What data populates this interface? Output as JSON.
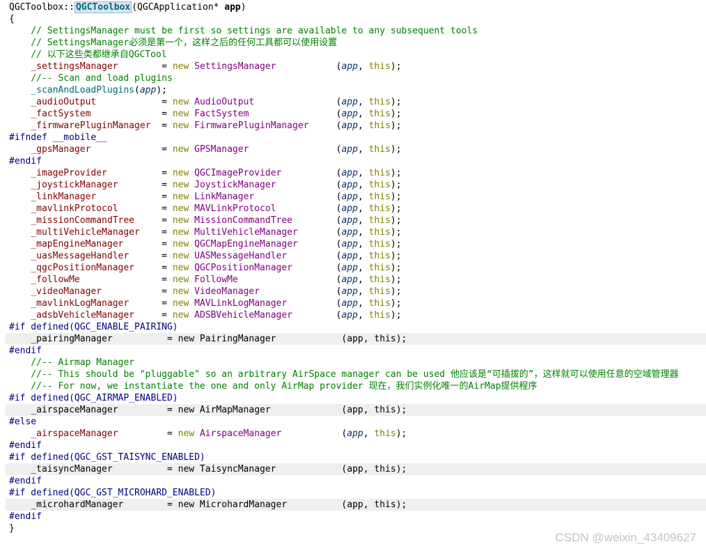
{
  "watermark": "CSDN @weixin_43409627",
  "lines": [
    {
      "disabled": false,
      "tokens": [
        {
          "t": "QGCToolbox",
          "c": "ctx"
        },
        {
          "t": "::",
          "c": "ctx"
        },
        {
          "t": "QGCToolbox",
          "c": "hl"
        },
        {
          "t": "(",
          "c": "ctx"
        },
        {
          "t": "QGCApplication",
          "c": "ctx"
        },
        {
          "t": "* ",
          "c": "ctx"
        },
        {
          "t": "app",
          "c": "ctx bold"
        },
        {
          "t": ")",
          "c": "ctx"
        }
      ]
    },
    {
      "disabled": false,
      "tokens": [
        {
          "t": "{",
          "c": "ctx"
        }
      ]
    },
    {
      "disabled": false,
      "tokens": [
        {
          "t": "    // SettingsManager must be first so settings are available to any subsequent tools",
          "c": "cmt"
        }
      ]
    },
    {
      "disabled": false,
      "tokens": [
        {
          "t": "    // SettingsManager必须是第一个，这样之后的任何工具都可以使用设置",
          "c": "cmt"
        }
      ]
    },
    {
      "disabled": false,
      "tokens": [
        {
          "t": "    // 以下这些类都继承自QGCTool",
          "c": "cmt"
        }
      ]
    },
    {
      "disabled": false,
      "tokens": [
        {
          "t": "    _settingsManager",
          "c": "mem"
        },
        {
          "t": "        = ",
          "c": "ctx"
        },
        {
          "t": "new",
          "c": "kw"
        },
        {
          "t": " ",
          "c": "ctx"
        },
        {
          "t": "SettingsManager",
          "c": "type"
        },
        {
          "t": "           (",
          "c": "ctx"
        },
        {
          "t": "app",
          "c": "par"
        },
        {
          "t": ", ",
          "c": "ctx"
        },
        {
          "t": "this",
          "c": "kw"
        },
        {
          "t": ");",
          "c": "ctx"
        }
      ]
    },
    {
      "disabled": false,
      "tokens": [
        {
          "t": "    //-- Scan and load plugins",
          "c": "cmt"
        }
      ]
    },
    {
      "disabled": false,
      "tokens": [
        {
          "t": "    _scanAndLoadPlugins",
          "c": "fn"
        },
        {
          "t": "(",
          "c": "ctx"
        },
        {
          "t": "app",
          "c": "par"
        },
        {
          "t": ");",
          "c": "ctx"
        }
      ]
    },
    {
      "disabled": false,
      "tokens": [
        {
          "t": "    _audioOutput",
          "c": "mem"
        },
        {
          "t": "            = ",
          "c": "ctx"
        },
        {
          "t": "new",
          "c": "kw"
        },
        {
          "t": " ",
          "c": "ctx"
        },
        {
          "t": "AudioOutput",
          "c": "type"
        },
        {
          "t": "               (",
          "c": "ctx"
        },
        {
          "t": "app",
          "c": "par"
        },
        {
          "t": ", ",
          "c": "ctx"
        },
        {
          "t": "this",
          "c": "kw"
        },
        {
          "t": ");",
          "c": "ctx"
        }
      ]
    },
    {
      "disabled": false,
      "tokens": [
        {
          "t": "    _factSystem",
          "c": "mem"
        },
        {
          "t": "             = ",
          "c": "ctx"
        },
        {
          "t": "new",
          "c": "kw"
        },
        {
          "t": " ",
          "c": "ctx"
        },
        {
          "t": "FactSystem",
          "c": "type"
        },
        {
          "t": "                (",
          "c": "ctx"
        },
        {
          "t": "app",
          "c": "par"
        },
        {
          "t": ", ",
          "c": "ctx"
        },
        {
          "t": "this",
          "c": "kw"
        },
        {
          "t": ");",
          "c": "ctx"
        }
      ]
    },
    {
      "disabled": false,
      "tokens": [
        {
          "t": "    _firmwarePluginManager",
          "c": "mem"
        },
        {
          "t": "  = ",
          "c": "ctx"
        },
        {
          "t": "new",
          "c": "kw"
        },
        {
          "t": " ",
          "c": "ctx"
        },
        {
          "t": "FirmwarePluginManager",
          "c": "type"
        },
        {
          "t": "     (",
          "c": "ctx"
        },
        {
          "t": "app",
          "c": "par"
        },
        {
          "t": ", ",
          "c": "ctx"
        },
        {
          "t": "this",
          "c": "kw"
        },
        {
          "t": ");",
          "c": "ctx"
        }
      ]
    },
    {
      "disabled": false,
      "tokens": [
        {
          "t": "#ifndef __mobile__",
          "c": "pp"
        }
      ]
    },
    {
      "disabled": false,
      "tokens": [
        {
          "t": "    _gpsManager",
          "c": "mem"
        },
        {
          "t": "             = ",
          "c": "ctx"
        },
        {
          "t": "new",
          "c": "kw"
        },
        {
          "t": " ",
          "c": "ctx"
        },
        {
          "t": "GPSManager",
          "c": "type"
        },
        {
          "t": "                (",
          "c": "ctx"
        },
        {
          "t": "app",
          "c": "par"
        },
        {
          "t": ", ",
          "c": "ctx"
        },
        {
          "t": "this",
          "c": "kw"
        },
        {
          "t": ");",
          "c": "ctx"
        }
      ]
    },
    {
      "disabled": false,
      "tokens": [
        {
          "t": "#endif",
          "c": "pp"
        }
      ]
    },
    {
      "disabled": false,
      "tokens": [
        {
          "t": "    _imageProvider",
          "c": "mem"
        },
        {
          "t": "          = ",
          "c": "ctx"
        },
        {
          "t": "new",
          "c": "kw"
        },
        {
          "t": " ",
          "c": "ctx"
        },
        {
          "t": "QGCImageProvider",
          "c": "type"
        },
        {
          "t": "          (",
          "c": "ctx"
        },
        {
          "t": "app",
          "c": "par"
        },
        {
          "t": ", ",
          "c": "ctx"
        },
        {
          "t": "this",
          "c": "kw"
        },
        {
          "t": ");",
          "c": "ctx"
        }
      ]
    },
    {
      "disabled": false,
      "tokens": [
        {
          "t": "    _joystickManager",
          "c": "mem"
        },
        {
          "t": "        = ",
          "c": "ctx"
        },
        {
          "t": "new",
          "c": "kw"
        },
        {
          "t": " ",
          "c": "ctx"
        },
        {
          "t": "JoystickManager",
          "c": "type"
        },
        {
          "t": "           (",
          "c": "ctx"
        },
        {
          "t": "app",
          "c": "par"
        },
        {
          "t": ", ",
          "c": "ctx"
        },
        {
          "t": "this",
          "c": "kw"
        },
        {
          "t": ");",
          "c": "ctx"
        }
      ]
    },
    {
      "disabled": false,
      "tokens": [
        {
          "t": "    _linkManager",
          "c": "mem"
        },
        {
          "t": "            = ",
          "c": "ctx"
        },
        {
          "t": "new",
          "c": "kw"
        },
        {
          "t": " ",
          "c": "ctx"
        },
        {
          "t": "LinkManager",
          "c": "type"
        },
        {
          "t": "               (",
          "c": "ctx"
        },
        {
          "t": "app",
          "c": "par"
        },
        {
          "t": ", ",
          "c": "ctx"
        },
        {
          "t": "this",
          "c": "kw"
        },
        {
          "t": ");",
          "c": "ctx"
        }
      ]
    },
    {
      "disabled": false,
      "tokens": [
        {
          "t": "    _mavlinkProtocol",
          "c": "mem"
        },
        {
          "t": "        = ",
          "c": "ctx"
        },
        {
          "t": "new",
          "c": "kw"
        },
        {
          "t": " ",
          "c": "ctx"
        },
        {
          "t": "MAVLinkProtocol",
          "c": "type"
        },
        {
          "t": "           (",
          "c": "ctx"
        },
        {
          "t": "app",
          "c": "par"
        },
        {
          "t": ", ",
          "c": "ctx"
        },
        {
          "t": "this",
          "c": "kw"
        },
        {
          "t": ");",
          "c": "ctx"
        }
      ]
    },
    {
      "disabled": false,
      "tokens": [
        {
          "t": "    _missionCommandTree",
          "c": "mem"
        },
        {
          "t": "     = ",
          "c": "ctx"
        },
        {
          "t": "new",
          "c": "kw"
        },
        {
          "t": " ",
          "c": "ctx"
        },
        {
          "t": "MissionCommandTree",
          "c": "type"
        },
        {
          "t": "        (",
          "c": "ctx"
        },
        {
          "t": "app",
          "c": "par"
        },
        {
          "t": ", ",
          "c": "ctx"
        },
        {
          "t": "this",
          "c": "kw"
        },
        {
          "t": ");",
          "c": "ctx"
        }
      ]
    },
    {
      "disabled": false,
      "tokens": [
        {
          "t": "    _multiVehicleManager",
          "c": "mem"
        },
        {
          "t": "    = ",
          "c": "ctx"
        },
        {
          "t": "new",
          "c": "kw"
        },
        {
          "t": " ",
          "c": "ctx"
        },
        {
          "t": "MultiVehicleManager",
          "c": "type"
        },
        {
          "t": "       (",
          "c": "ctx"
        },
        {
          "t": "app",
          "c": "par"
        },
        {
          "t": ", ",
          "c": "ctx"
        },
        {
          "t": "this",
          "c": "kw"
        },
        {
          "t": ");",
          "c": "ctx"
        }
      ]
    },
    {
      "disabled": false,
      "tokens": [
        {
          "t": "    _mapEngineManager",
          "c": "mem"
        },
        {
          "t": "       = ",
          "c": "ctx"
        },
        {
          "t": "new",
          "c": "kw"
        },
        {
          "t": " ",
          "c": "ctx"
        },
        {
          "t": "QGCMapEngineManager",
          "c": "type"
        },
        {
          "t": "       (",
          "c": "ctx"
        },
        {
          "t": "app",
          "c": "par"
        },
        {
          "t": ", ",
          "c": "ctx"
        },
        {
          "t": "this",
          "c": "kw"
        },
        {
          "t": ");",
          "c": "ctx"
        }
      ]
    },
    {
      "disabled": false,
      "tokens": [
        {
          "t": "    _uasMessageHandler",
          "c": "mem"
        },
        {
          "t": "      = ",
          "c": "ctx"
        },
        {
          "t": "new",
          "c": "kw"
        },
        {
          "t": " ",
          "c": "ctx"
        },
        {
          "t": "UASMessageHandler",
          "c": "type"
        },
        {
          "t": "         (",
          "c": "ctx"
        },
        {
          "t": "app",
          "c": "par"
        },
        {
          "t": ", ",
          "c": "ctx"
        },
        {
          "t": "this",
          "c": "kw"
        },
        {
          "t": ");",
          "c": "ctx"
        }
      ]
    },
    {
      "disabled": false,
      "tokens": [
        {
          "t": "    _qgcPositionManager",
          "c": "mem"
        },
        {
          "t": "     = ",
          "c": "ctx"
        },
        {
          "t": "new",
          "c": "kw"
        },
        {
          "t": " ",
          "c": "ctx"
        },
        {
          "t": "QGCPositionManager",
          "c": "type"
        },
        {
          "t": "        (",
          "c": "ctx"
        },
        {
          "t": "app",
          "c": "par"
        },
        {
          "t": ", ",
          "c": "ctx"
        },
        {
          "t": "this",
          "c": "kw"
        },
        {
          "t": ");",
          "c": "ctx"
        }
      ]
    },
    {
      "disabled": false,
      "tokens": [
        {
          "t": "    _followMe",
          "c": "mem"
        },
        {
          "t": "               = ",
          "c": "ctx"
        },
        {
          "t": "new",
          "c": "kw"
        },
        {
          "t": " ",
          "c": "ctx"
        },
        {
          "t": "FollowMe",
          "c": "type"
        },
        {
          "t": "                  (",
          "c": "ctx"
        },
        {
          "t": "app",
          "c": "par"
        },
        {
          "t": ", ",
          "c": "ctx"
        },
        {
          "t": "this",
          "c": "kw"
        },
        {
          "t": ");",
          "c": "ctx"
        }
      ]
    },
    {
      "disabled": false,
      "tokens": [
        {
          "t": "    _videoManager",
          "c": "mem"
        },
        {
          "t": "           = ",
          "c": "ctx"
        },
        {
          "t": "new",
          "c": "kw"
        },
        {
          "t": " ",
          "c": "ctx"
        },
        {
          "t": "VideoManager",
          "c": "type"
        },
        {
          "t": "              (",
          "c": "ctx"
        },
        {
          "t": "app",
          "c": "par"
        },
        {
          "t": ", ",
          "c": "ctx"
        },
        {
          "t": "this",
          "c": "kw"
        },
        {
          "t": ");",
          "c": "ctx"
        }
      ]
    },
    {
      "disabled": false,
      "tokens": [
        {
          "t": "    _mavlinkLogManager",
          "c": "mem"
        },
        {
          "t": "      = ",
          "c": "ctx"
        },
        {
          "t": "new",
          "c": "kw"
        },
        {
          "t": " ",
          "c": "ctx"
        },
        {
          "t": "MAVLinkLogManager",
          "c": "type"
        },
        {
          "t": "         (",
          "c": "ctx"
        },
        {
          "t": "app",
          "c": "par"
        },
        {
          "t": ", ",
          "c": "ctx"
        },
        {
          "t": "this",
          "c": "kw"
        },
        {
          "t": ");",
          "c": "ctx"
        }
      ]
    },
    {
      "disabled": false,
      "tokens": [
        {
          "t": "    _adsbVehicleManager",
          "c": "mem"
        },
        {
          "t": "     = ",
          "c": "ctx"
        },
        {
          "t": "new",
          "c": "kw"
        },
        {
          "t": " ",
          "c": "ctx"
        },
        {
          "t": "ADSBVehicleManager",
          "c": "type"
        },
        {
          "t": "        (",
          "c": "ctx"
        },
        {
          "t": "app",
          "c": "par"
        },
        {
          "t": ", ",
          "c": "ctx"
        },
        {
          "t": "this",
          "c": "kw"
        },
        {
          "t": ");",
          "c": "ctx"
        }
      ]
    },
    {
      "disabled": false,
      "tokens": [
        {
          "t": "#if defined(QGC_ENABLE_PAIRING)",
          "c": "pp"
        }
      ]
    },
    {
      "disabled": true,
      "tokens": [
        {
          "t": "    _pairingManager          = new PairingManager            (app, this);",
          "c": "ctx"
        }
      ]
    },
    {
      "disabled": false,
      "tokens": [
        {
          "t": "#endif",
          "c": "pp"
        }
      ]
    },
    {
      "disabled": false,
      "tokens": [
        {
          "t": "    //-- Airmap Manager",
          "c": "cmt"
        }
      ]
    },
    {
      "disabled": false,
      "tokens": [
        {
          "t": "    //-- This should be \"pluggable\" so an arbitrary AirSpace manager can be used 他应该是“可插拔的”，这样就可以使用任意的空域管理器",
          "c": "cmt"
        }
      ]
    },
    {
      "disabled": false,
      "tokens": [
        {
          "t": "    //-- For now, we instantiate the one and only AirMap provider 现在，我们实例化唯一的AirMap提供程序",
          "c": "cmt"
        }
      ]
    },
    {
      "disabled": false,
      "tokens": [
        {
          "t": "#if defined(QGC_AIRMAP_ENABLED)",
          "c": "pp"
        }
      ]
    },
    {
      "disabled": true,
      "tokens": [
        {
          "t": "    _airspaceManager         = new AirMapManager             (app, this);",
          "c": "ctx"
        }
      ]
    },
    {
      "disabled": false,
      "tokens": [
        {
          "t": "#else",
          "c": "pp"
        }
      ]
    },
    {
      "disabled": false,
      "tokens": [
        {
          "t": "    _airspaceManager",
          "c": "mem"
        },
        {
          "t": "         = ",
          "c": "ctx"
        },
        {
          "t": "new",
          "c": "kw"
        },
        {
          "t": " ",
          "c": "ctx"
        },
        {
          "t": "AirspaceManager",
          "c": "type"
        },
        {
          "t": "           (",
          "c": "ctx"
        },
        {
          "t": "app",
          "c": "par"
        },
        {
          "t": ", ",
          "c": "ctx"
        },
        {
          "t": "this",
          "c": "kw"
        },
        {
          "t": ");",
          "c": "ctx"
        }
      ]
    },
    {
      "disabled": false,
      "tokens": [
        {
          "t": "#endif",
          "c": "pp"
        }
      ]
    },
    {
      "disabled": false,
      "tokens": [
        {
          "t": "#if defined(QGC_GST_TAISYNC_ENABLED)",
          "c": "pp"
        }
      ]
    },
    {
      "disabled": true,
      "tokens": [
        {
          "t": "    _taisyncManager          = new TaisyncManager            (app, this);",
          "c": "ctx"
        }
      ]
    },
    {
      "disabled": false,
      "tokens": [
        {
          "t": "#endif",
          "c": "pp"
        }
      ]
    },
    {
      "disabled": false,
      "tokens": [
        {
          "t": "#if defined(QGC_GST_MICROHARD_ENABLED)",
          "c": "pp"
        }
      ]
    },
    {
      "disabled": true,
      "tokens": [
        {
          "t": "    _microhardManager        = new MicrohardManager          (app, this);",
          "c": "ctx"
        }
      ]
    },
    {
      "disabled": false,
      "tokens": [
        {
          "t": "#endif",
          "c": "pp"
        }
      ]
    },
    {
      "disabled": false,
      "tokens": [
        {
          "t": "}",
          "c": "ctx"
        }
      ]
    }
  ]
}
